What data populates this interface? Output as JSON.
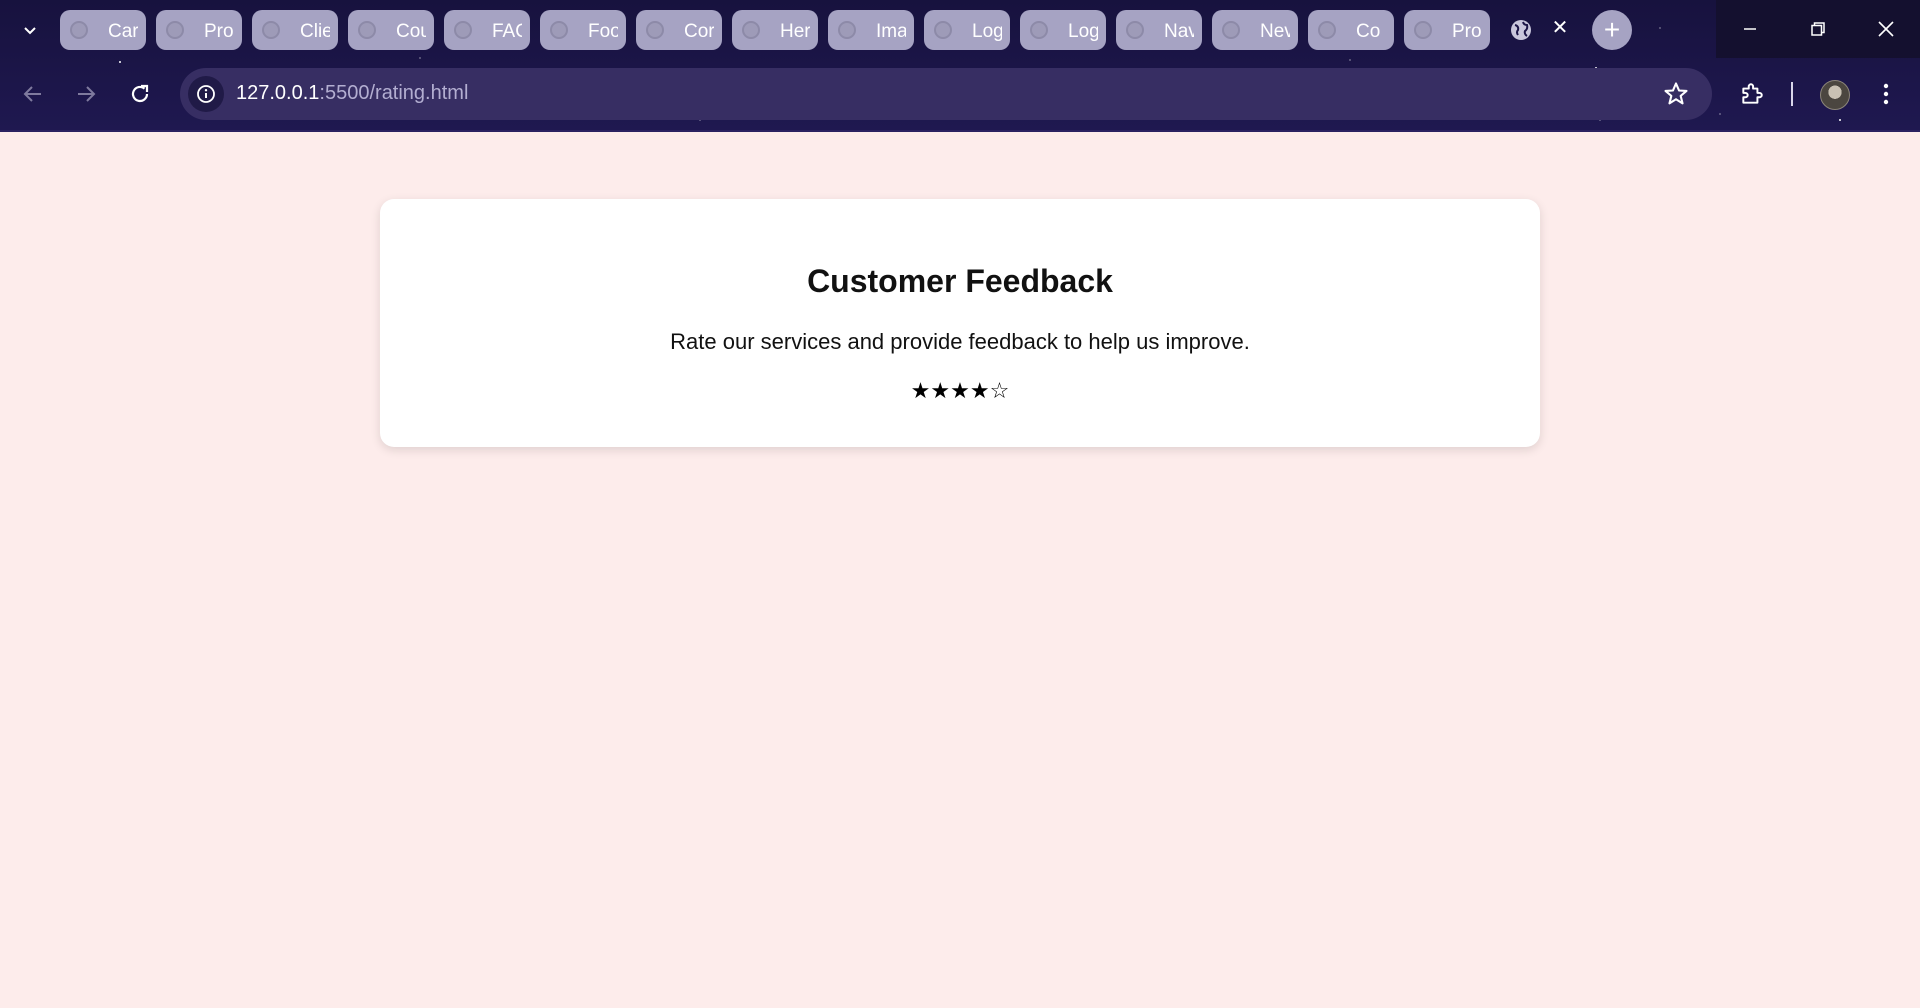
{
  "browser": {
    "tabs": [
      {
        "label": "Car"
      },
      {
        "label": "Pro"
      },
      {
        "label": "Clie"
      },
      {
        "label": "Cou"
      },
      {
        "label": "FAQ"
      },
      {
        "label": "Foo"
      },
      {
        "label": "Cor"
      },
      {
        "label": "Her"
      },
      {
        "label": "Ima"
      },
      {
        "label": "Log"
      },
      {
        "label": "Log"
      },
      {
        "label": "Nav"
      },
      {
        "label": "Nev"
      },
      {
        "label": "Co"
      },
      {
        "label": "Pro"
      }
    ],
    "active_tab_close": "✕",
    "new_tab_label": "+",
    "url_host": "127.0.0.1",
    "url_path": ":5500/rating.html"
  },
  "card": {
    "title": "Customer Feedback",
    "subtitle": "Rate our services and provide feedback to help us improve.",
    "rating": {
      "value": 4,
      "max": 5,
      "filled": "★",
      "empty": "☆"
    }
  },
  "colors": {
    "page_background": "#fdeceb",
    "card_background": "#ffffff",
    "chrome_background": "#1c1547"
  }
}
